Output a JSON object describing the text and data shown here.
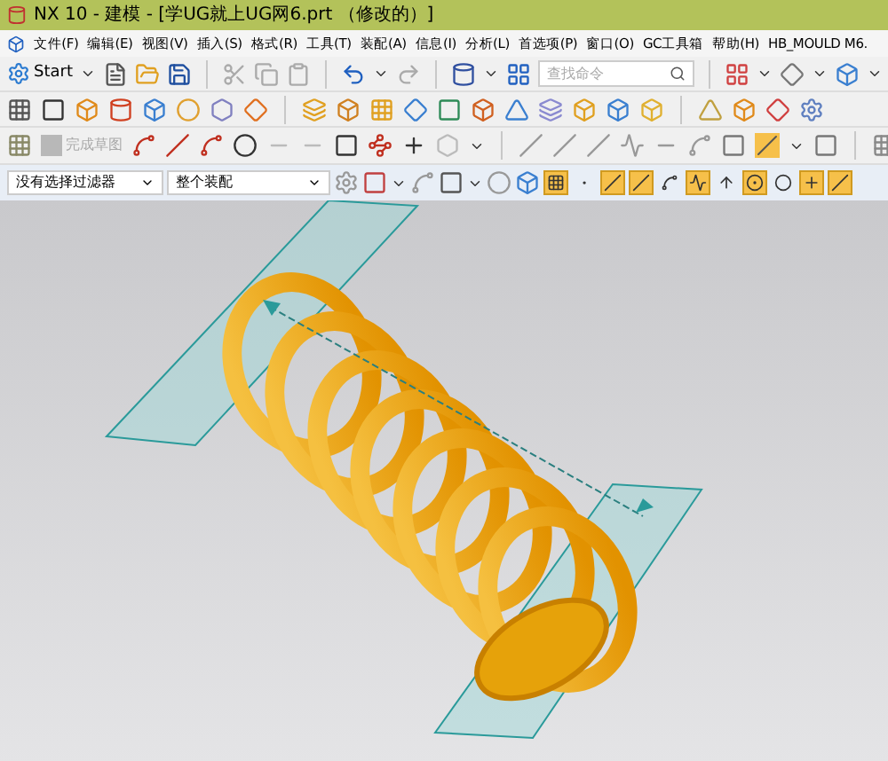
{
  "window": {
    "title": "NX 10 - 建模 - [学UG就上UG网6.prt （修改的）]"
  },
  "menu": [
    "文件(F)",
    "编辑(E)",
    "视图(V)",
    "插入(S)",
    "格式(R)",
    "工具(T)",
    "装配(A)",
    "信息(I)",
    "分析(L)",
    "首选项(P)",
    "窗口(O)",
    "GC工具箱",
    "帮助(H)",
    "HB_MOULD M6."
  ],
  "toolbar": {
    "start_label": "Start",
    "search": {
      "placeholder": "查找命令"
    },
    "finish_sketch": {
      "label": "完成草图",
      "disabled": true
    }
  },
  "selection_bar": {
    "filter": "没有选择过滤器",
    "scope": "整个装配"
  },
  "snap_buttons": [
    {
      "kind": "points",
      "on": true
    },
    {
      "kind": "nodes",
      "on": false
    },
    {
      "kind": "line",
      "on": true
    },
    {
      "kind": "line",
      "on": true
    },
    {
      "kind": "curve",
      "on": false
    },
    {
      "kind": "wave",
      "on": true
    },
    {
      "kind": "perpendicular",
      "on": false
    },
    {
      "kind": "center",
      "on": true
    },
    {
      "kind": "circle",
      "on": false
    },
    {
      "kind": "plus",
      "on": true
    },
    {
      "kind": "line",
      "on": true
    }
  ]
}
